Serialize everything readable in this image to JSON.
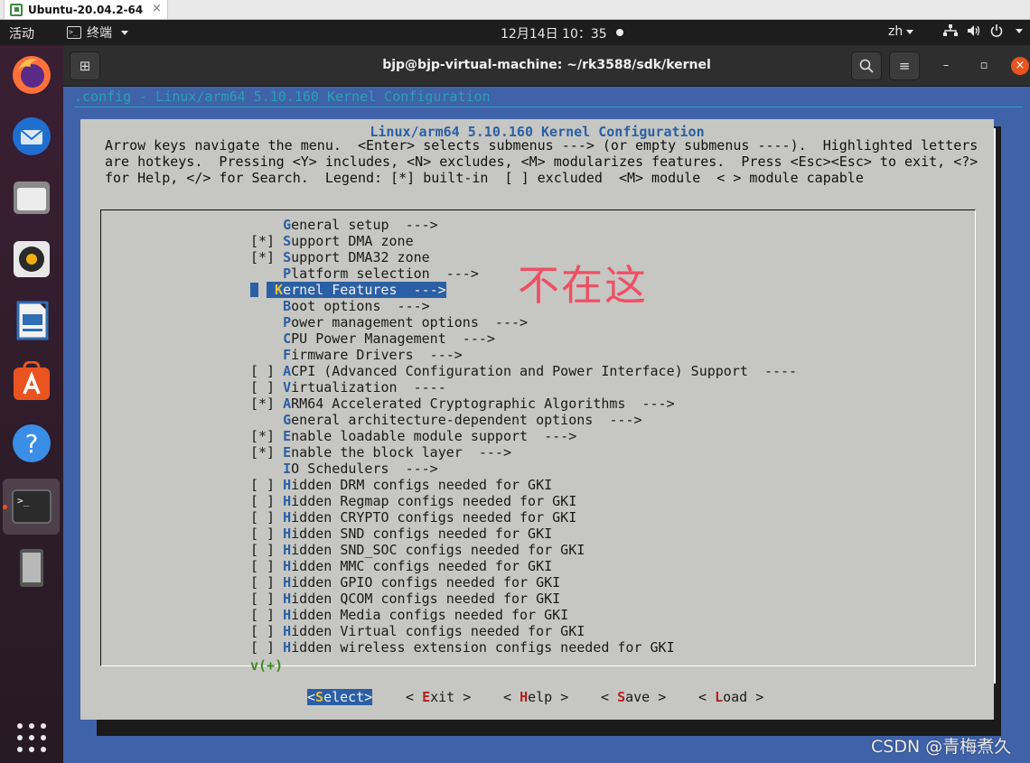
{
  "vm_tab": {
    "label": "Ubuntu-20.04.2-64",
    "close": "×"
  },
  "topbar": {
    "activities": "活动",
    "app": "终端",
    "clock": "12月14日  10：35",
    "lang": "zh"
  },
  "window": {
    "title": "bjp@bjp-virtual-machine: ~/rk3588/sdk/kernel",
    "new_tab": "⊞",
    "search": "⌕",
    "menu": "≡",
    "minimize": "–",
    "maximize": "▫",
    "close": "×"
  },
  "terminal": {
    "header": ".config - Linux/arm64 5.10.160 Kernel Configuration",
    "dialog_title": "Linux/arm64 5.10.160 Kernel Configuration",
    "help": [
      "Arrow keys navigate the menu.  <Enter> selects submenus ---> (or empty submenus ----).  Highlighted letters",
      "are hotkeys.  Pressing <Y> includes, <N> excludes, <M> modularizes features.  Press <Esc><Esc> to exit, <?>",
      "for Help, </> for Search.  Legend: [*] built-in  [ ] excluded  <M> module  < > module capable"
    ],
    "menu_items": [
      {
        "prefix": "    ",
        "hotkey": "G",
        "rest": "eneral setup  --->"
      },
      {
        "prefix": "[*] ",
        "hotkey": "S",
        "rest": "upport DMA zone"
      },
      {
        "prefix": "[*] ",
        "hotkey": "S",
        "rest": "upport DMA32 zone"
      },
      {
        "prefix": "    ",
        "hotkey": "P",
        "rest": "latform selection  --->"
      },
      {
        "prefix": "    ",
        "hotkey": "K",
        "rest": "ernel Features  --->",
        "selected": true
      },
      {
        "prefix": "    ",
        "hotkey": "B",
        "rest": "oot options  --->"
      },
      {
        "prefix": "    ",
        "hotkey": "P",
        "rest": "ower management options  --->"
      },
      {
        "prefix": "    ",
        "hotkey": "C",
        "rest": "PU Power Management  --->"
      },
      {
        "prefix": "    ",
        "hotkey": "F",
        "rest": "irmware Drivers  --->"
      },
      {
        "prefix": "[ ] ",
        "hotkey": "A",
        "rest": "CPI (Advanced Configuration and Power Interface) Support  ----"
      },
      {
        "prefix": "[ ] ",
        "hotkey": "V",
        "rest": "irtualization  ----"
      },
      {
        "prefix": "[*] ",
        "hotkey": "A",
        "rest": "RM64 Accelerated Cryptographic Algorithms  --->"
      },
      {
        "prefix": "    ",
        "hotkey": "G",
        "rest": "eneral architecture-dependent options  --->"
      },
      {
        "prefix": "[*] ",
        "hotkey": "E",
        "rest": "nable loadable module support  --->"
      },
      {
        "prefix": "[*] ",
        "hotkey": "E",
        "rest": "nable the block layer  --->"
      },
      {
        "prefix": "    ",
        "hotkey": "I",
        "rest": "O Schedulers  --->"
      },
      {
        "prefix": "[ ] ",
        "hotkey": "H",
        "rest": "idden DRM configs needed for GKI"
      },
      {
        "prefix": "[ ] ",
        "hotkey": "H",
        "rest": "idden Regmap configs needed for GKI"
      },
      {
        "prefix": "[ ] ",
        "hotkey": "H",
        "rest": "idden CRYPTO configs needed for GKI"
      },
      {
        "prefix": "[ ] ",
        "hotkey": "H",
        "rest": "idden SND configs needed for GKI"
      },
      {
        "prefix": "[ ] ",
        "hotkey": "H",
        "rest": "idden SND_SOC configs needed for GKI"
      },
      {
        "prefix": "[ ] ",
        "hotkey": "H",
        "rest": "idden MMC configs needed for GKI"
      },
      {
        "prefix": "[ ] ",
        "hotkey": "H",
        "rest": "idden GPIO configs needed for GKI"
      },
      {
        "prefix": "[ ] ",
        "hotkey": "H",
        "rest": "idden QCOM configs needed for GKI"
      },
      {
        "prefix": "[ ] ",
        "hotkey": "H",
        "rest": "idden Media configs needed for GKI"
      },
      {
        "prefix": "[ ] ",
        "hotkey": "H",
        "rest": "idden Virtual configs needed for GKI"
      },
      {
        "prefix": "[ ] ",
        "hotkey": "H",
        "rest": "idden wireless extension configs needed for GKI"
      }
    ],
    "more_indicator": "v(+)",
    "buttons": [
      {
        "open": "<",
        "hotkey": "S",
        "rest": "elect",
        "close": ">",
        "selected": true
      },
      {
        "open": "< ",
        "hotkey": "E",
        "rest": "xit",
        "close": " >"
      },
      {
        "open": "< ",
        "hotkey": "H",
        "rest": "elp",
        "close": " >"
      },
      {
        "open": "< ",
        "hotkey": "S",
        "rest": "ave",
        "close": " >"
      },
      {
        "open": "< ",
        "hotkey": "L",
        "rest": "oad",
        "close": " >"
      }
    ]
  },
  "annotation": "不在这",
  "watermark": "CSDN @青梅煮久",
  "dock": [
    "firefox-icon",
    "thunderbird-icon",
    "files-icon",
    "rhythmbox-icon",
    "writer-icon",
    "software-icon",
    "help-icon",
    "terminal-icon",
    "device-icon",
    "app-grid-icon"
  ],
  "colors": {
    "accent": "#e95420",
    "terminal_bg": "#3f62a8",
    "dialog_bg": "#c6c7c2",
    "highlight": "#2b5fa5"
  }
}
